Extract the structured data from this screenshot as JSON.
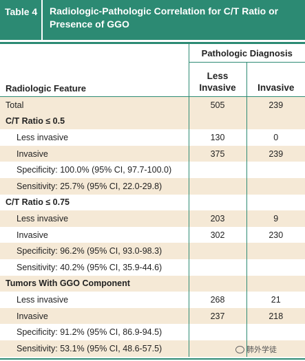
{
  "table_label": "Table 4",
  "table_title": "Radiologic-Pathologic Correlation for C/T Ratio or Presence of GGO",
  "header": {
    "feature_col": "Radiologic Feature",
    "group_col": "Pathologic Diagnosis",
    "col_less": "Less Invasive",
    "col_invasive": "Invasive"
  },
  "rows": [
    {
      "label": "Total",
      "less": "505",
      "inv": "239"
    },
    {
      "label": "C/T Ratio ≤ 0.5",
      "less": "",
      "inv": ""
    },
    {
      "label": "Less invasive",
      "less": "130",
      "inv": "0"
    },
    {
      "label": "Invasive",
      "less": "375",
      "inv": "239"
    },
    {
      "label": "Specificity: 100.0% (95% CI, 97.7-100.0)",
      "less": "",
      "inv": ""
    },
    {
      "label": "Sensitivity: 25.7% (95% CI, 22.0-29.8)",
      "less": "",
      "inv": ""
    },
    {
      "label": "C/T Ratio ≤ 0.75",
      "less": "",
      "inv": ""
    },
    {
      "label": "Less invasive",
      "less": "203",
      "inv": "9"
    },
    {
      "label": "Invasive",
      "less": "302",
      "inv": "230"
    },
    {
      "label": "Specificity: 96.2% (95% CI, 93.0-98.3)",
      "less": "",
      "inv": ""
    },
    {
      "label": "Sensitivity: 40.2% (95% CI, 35.9-44.6)",
      "less": "",
      "inv": ""
    },
    {
      "label": "Tumors With GGO Component",
      "less": "",
      "inv": ""
    },
    {
      "label": "Less invasive",
      "less": "268",
      "inv": "21"
    },
    {
      "label": "Invasive",
      "less": "237",
      "inv": "218"
    },
    {
      "label": "Specificity: 91.2% (95% CI, 86.9-94.5)",
      "less": "",
      "inv": ""
    },
    {
      "label": "Sensitivity: 53.1% (95% CI, 48.6-57.5)",
      "less": "",
      "inv": ""
    }
  ],
  "watermark": "肺外学徒",
  "watermark_icon": "wechat-icon",
  "colors": {
    "accent": "#2c8a73",
    "shade": "#f5e9d6"
  }
}
